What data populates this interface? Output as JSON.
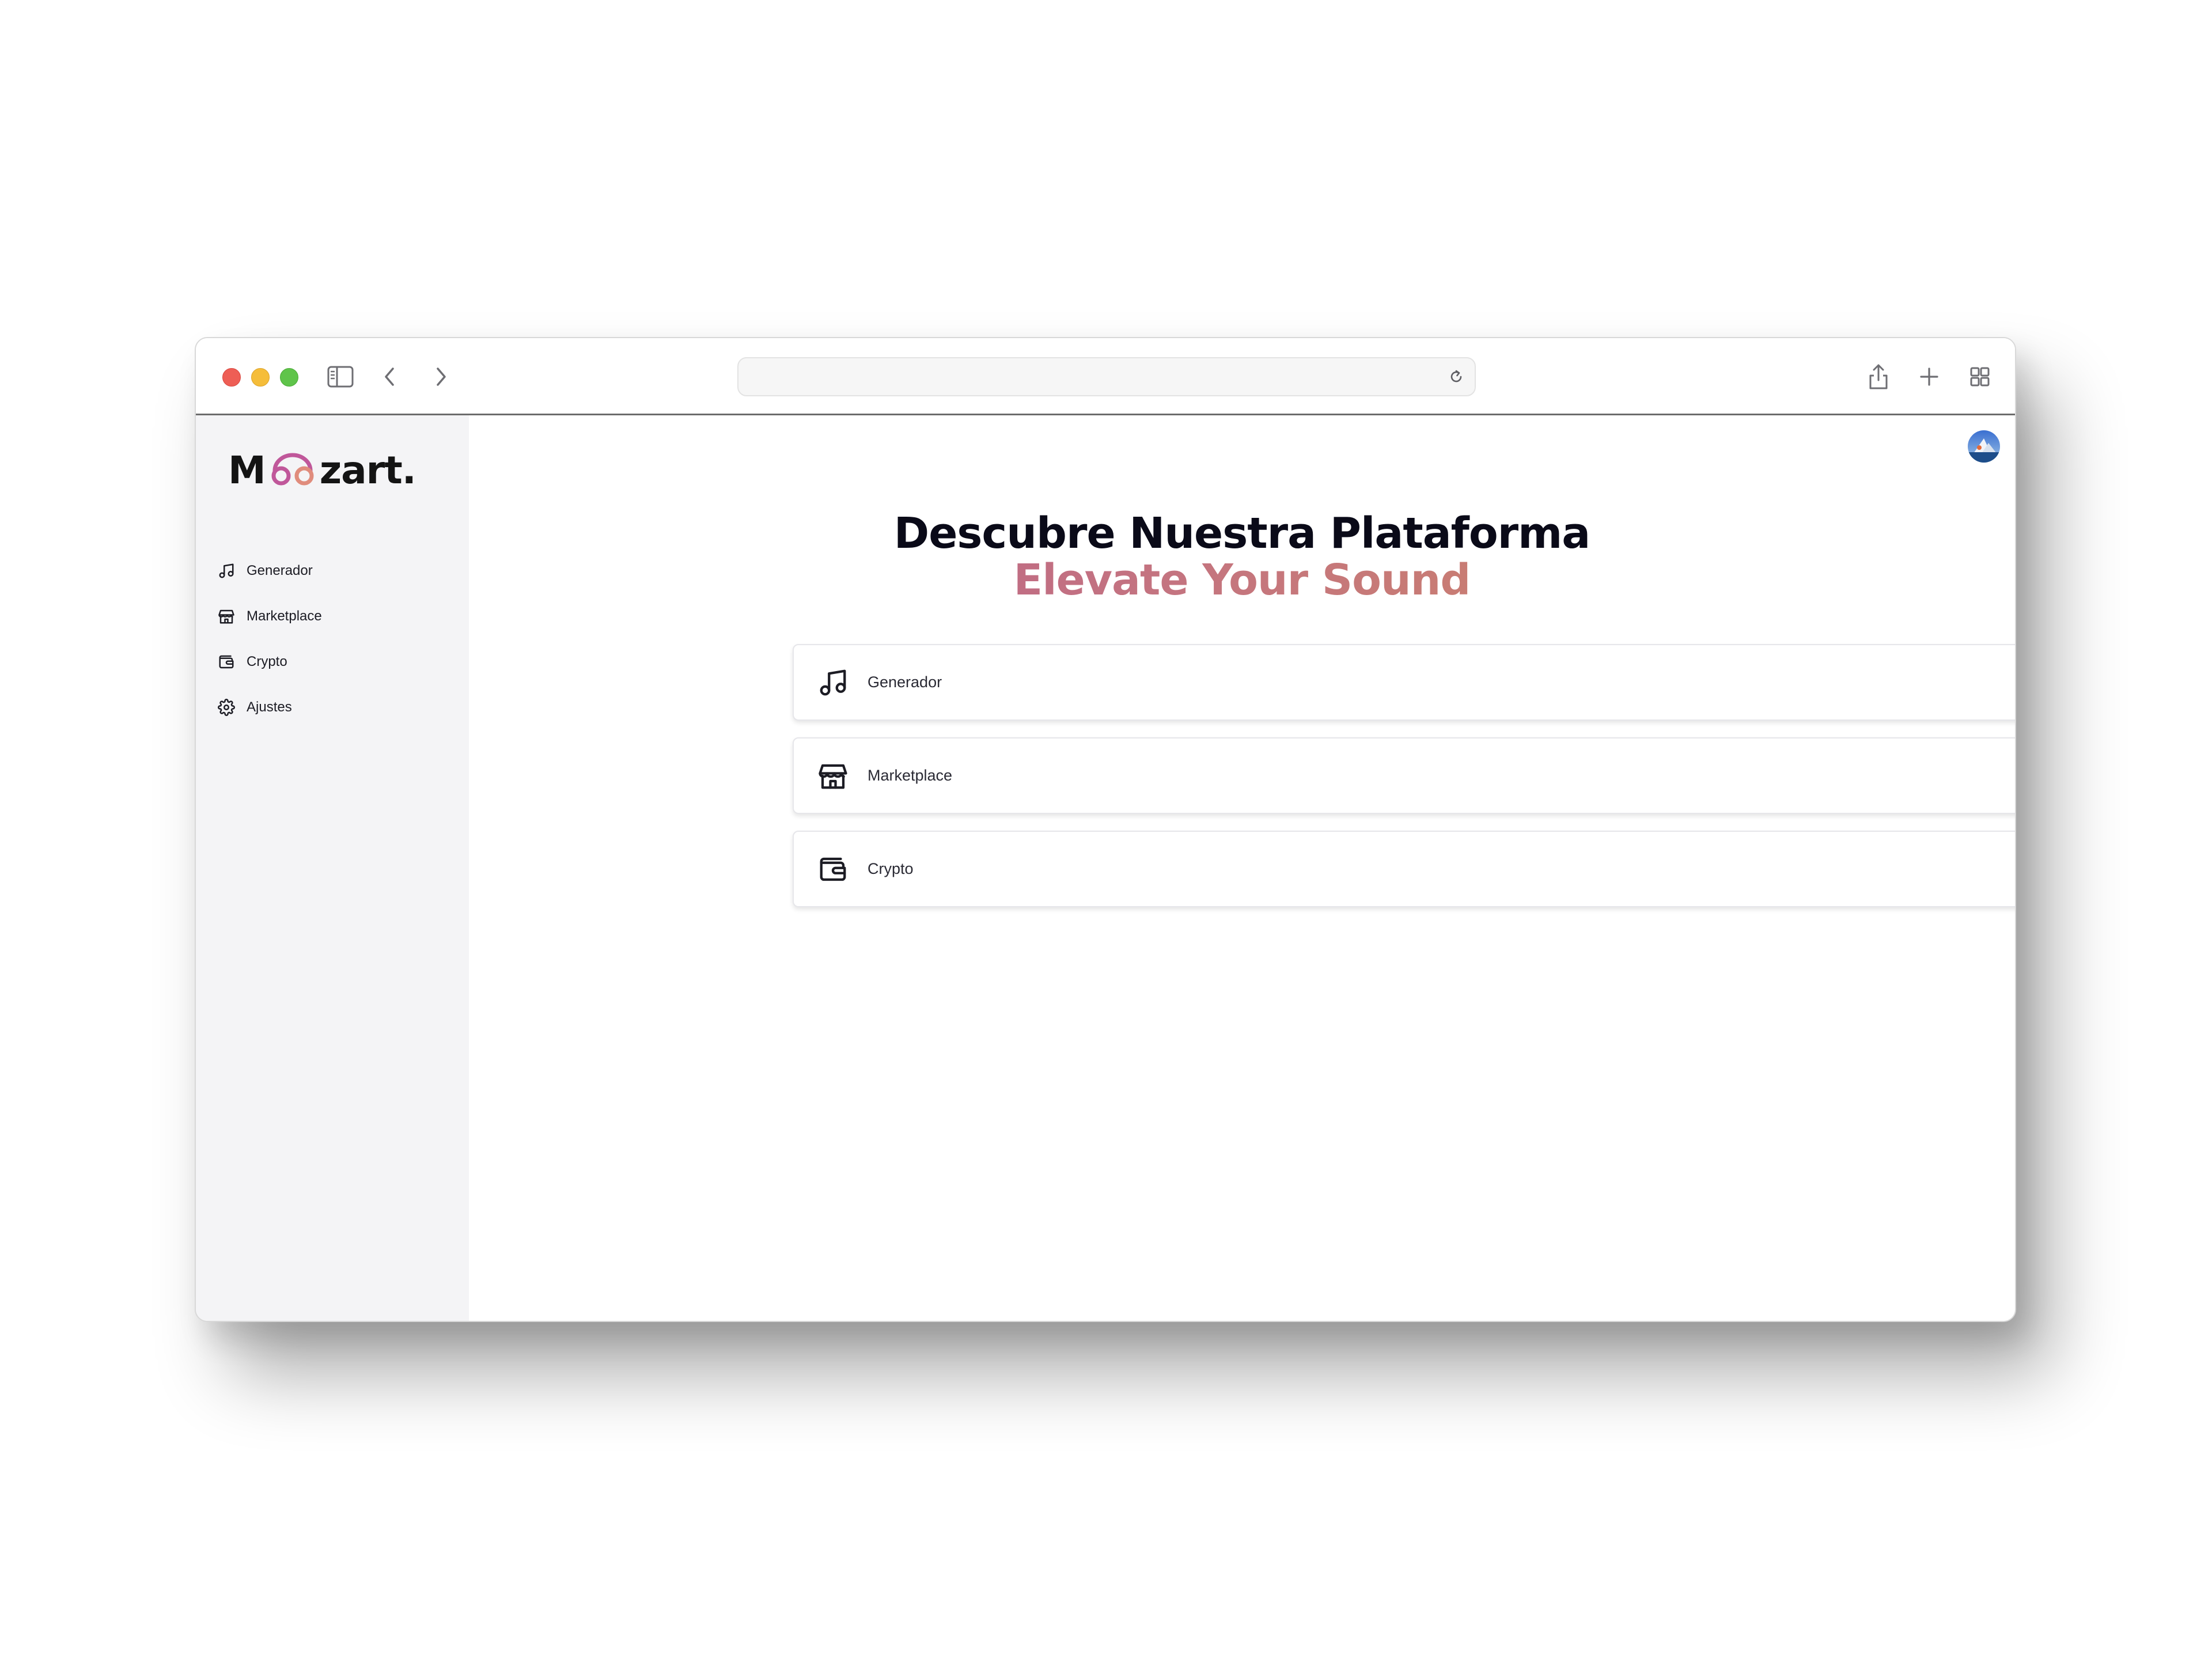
{
  "browser": {
    "url": "",
    "toolbar_icons": [
      "sidebar-toggle-icon",
      "back-chevron-icon",
      "forward-chevron-icon",
      "reload-icon",
      "share-icon",
      "new-tab-icon",
      "tab-overview-icon"
    ]
  },
  "app": {
    "logo_prefix": "M",
    "logo_suffix": "zart.",
    "logo_colors": {
      "dark": "#141414",
      "pink": "#c0579a",
      "coral": "#e08c7c"
    }
  },
  "sidebar": {
    "items": [
      {
        "label": "Generador",
        "icon": "music-note-icon"
      },
      {
        "label": "Marketplace",
        "icon": "store-icon"
      },
      {
        "label": "Crypto",
        "icon": "wallet-icon"
      },
      {
        "label": "Ajustes",
        "icon": "gear-icon"
      }
    ]
  },
  "hero": {
    "title": "Descubre Nuestra Plataforma",
    "subtitle": "Elevate Your Sound",
    "subtitle_gradient": [
      "#b4558e",
      "#cf8a5e"
    ]
  },
  "cards": [
    {
      "label": "Generador",
      "icon": "music-note-icon"
    },
    {
      "label": "Marketplace",
      "icon": "store-icon"
    },
    {
      "label": "Crypto",
      "icon": "wallet-icon"
    }
  ]
}
